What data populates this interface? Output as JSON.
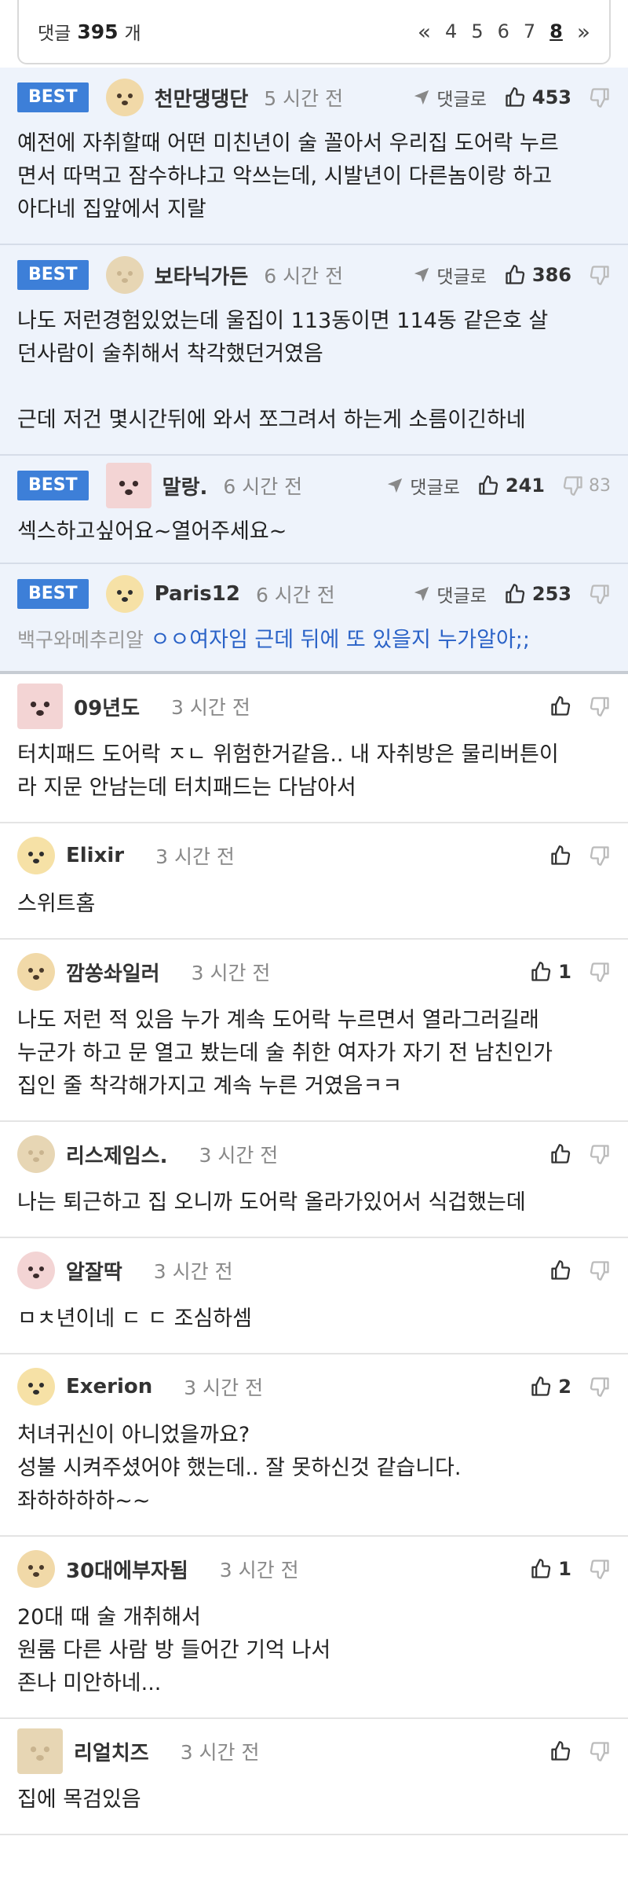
{
  "header": {
    "count_label": "댓글",
    "count": "395",
    "count_unit": "개"
  },
  "pager": {
    "prev": "«",
    "pages": [
      "4",
      "5",
      "6",
      "7"
    ],
    "current": "8",
    "next": "»"
  },
  "best_label": "BEST",
  "reply_label": "댓글로",
  "best_comments": [
    {
      "nick": "천만댕댕단",
      "time": "5 시간 전",
      "likes": "453",
      "dislikes": "",
      "lines": [
        "예전에 자취할때 어떤 미친년이 술 꼴아서 우리집 도어락 누르",
        "면서 따먹고 잠수하냐고 악쓰는데, 시발년이 다른놈이랑 하고",
        "아다네 집앞에서 지랄"
      ]
    },
    {
      "nick": "보타닉가든",
      "time": "6 시간 전",
      "likes": "386",
      "dislikes": "",
      "lines": [
        "나도 저런경험있었는데 울집이 113동이면 114동 같은호 살",
        "던사람이 술취해서 착각했던거였음",
        "",
        "근데 저건 몇시간뒤에 와서 쪼그려서 하는게 소름이긴하네"
      ]
    },
    {
      "nick": "말랑.",
      "time": "6 시간 전",
      "likes": "241",
      "dislikes": "83",
      "lines": [
        "섹스하고싶어요~열어주세요~"
      ]
    },
    {
      "nick": "Paris12",
      "time": "6 시간 전",
      "likes": "253",
      "dislikes": "",
      "reply_to": "백구와메추리알",
      "lines": [
        "ㅇㅇ여자임 근데 뒤에 또 있을지 누가알아;;"
      ]
    }
  ],
  "comments": [
    {
      "nick": "09년도",
      "time": "3 시간 전",
      "likes": "",
      "lines": [
        "터치패드 도어락 ㅈㄴ 위험한거같음.. 내 자취방은 물리버튼이",
        "라 지문 안남는데 터치패드는 다남아서"
      ]
    },
    {
      "nick": "Elixir",
      "time": "3 시간 전",
      "likes": "",
      "lines": [
        "스위트홈"
      ]
    },
    {
      "nick": "깜쏭솨일러",
      "time": "3 시간 전",
      "likes": "1",
      "lines": [
        "나도 저런 적 있음 누가 계속 도어락 누르면서 열라그러길래",
        "누군가 하고 문 열고 봤는데 술 취한 여자가 자기 전 남친인가",
        "집인 줄 착각해가지고 계속 누른 거였음ㅋㅋ"
      ]
    },
    {
      "nick": "리스제임스.",
      "time": "3 시간 전",
      "likes": "",
      "lines": [
        "나는 퇴근하고 집 오니까 도어락 올라가있어서 식겁했는데"
      ]
    },
    {
      "nick": "알잘딱",
      "time": "3 시간 전",
      "likes": "",
      "lines": [
        "ㅁㅊ년이네 ㄷ ㄷ 조심하셈"
      ]
    },
    {
      "nick": "Exerion",
      "time": "3 시간 전",
      "likes": "2",
      "lines": [
        "처녀귀신이 아니었을까요?",
        "성불 시켜주셨어야 했는데.. 잘 못하신것 같습니다.",
        "좌하하하하~~"
      ]
    },
    {
      "nick": "30대에부자됨",
      "time": "3 시간 전",
      "likes": "1",
      "lines": [
        "20대 때 술 개취해서",
        "원룸 다른 사람 방 들어간 기억 나서",
        "존나 미안하네..."
      ]
    },
    {
      "nick": "리얼치즈",
      "time": "3 시간 전",
      "likes": "",
      "lines": [
        "집에 목검있음"
      ]
    }
  ],
  "colors": {
    "best_bg": "#eef3fb",
    "badge": "#3d7fd8",
    "link": "#2a62c7"
  }
}
